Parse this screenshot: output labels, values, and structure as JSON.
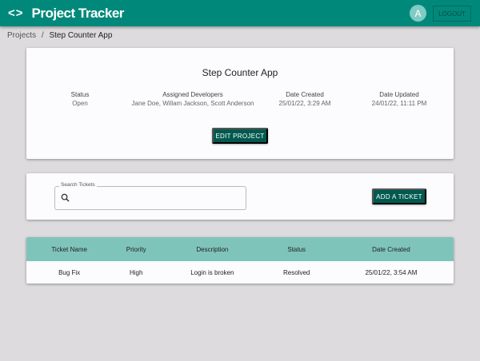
{
  "header": {
    "logo": "<>",
    "title": "Project Tracker",
    "avatar": "A",
    "logout": "LOGOUT"
  },
  "breadcrumb": {
    "parent": "Projects",
    "separator": "/",
    "current": "Step Counter App"
  },
  "project": {
    "title": "Step Counter App",
    "fields": [
      {
        "label": "Status",
        "value": "Open"
      },
      {
        "label": "Assigned Developers",
        "value": "Jane Doe, Willam Jackson, Scott Anderson"
      },
      {
        "label": "Date Created",
        "value": "25/01/22, 3:29 AM"
      },
      {
        "label": "Date Updated",
        "value": "24/01/22, 11:11 PM"
      }
    ],
    "edit": "EDIT PROJECT"
  },
  "search": {
    "label": "Search Tickets",
    "value": "",
    "add": "ADD A TICKET"
  },
  "tickets": {
    "headers": [
      "Ticket Name",
      "Priority",
      "Description",
      "Status",
      "Date Created"
    ],
    "rows": [
      [
        "Bug Fix",
        "High",
        "Login is broken",
        "Resolved",
        "25/01/22, 3:54 AM"
      ]
    ]
  },
  "colors": {
    "primary": "#00897b",
    "button": "#00594f",
    "table_header": "#7fc4bb"
  }
}
